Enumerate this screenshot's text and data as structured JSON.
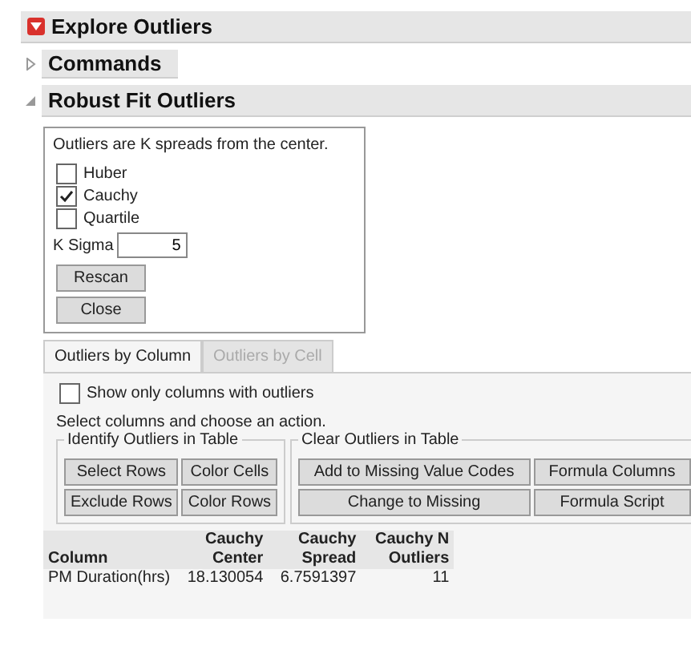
{
  "title": {
    "text": "Explore Outliers",
    "expanded": true
  },
  "commands": {
    "text": "Commands",
    "expanded": false
  },
  "robust": {
    "text": "Robust Fit Outliers",
    "expanded": true
  },
  "options": {
    "note": "Outliers are K spreads from the center.",
    "methods": [
      {
        "label": "Huber",
        "checked": false
      },
      {
        "label": "Cauchy",
        "checked": true
      },
      {
        "label": "Quartile",
        "checked": false
      }
    ],
    "k_sigma": {
      "label": "K Sigma",
      "value": "5"
    },
    "buttons": [
      "Rescan",
      "Close"
    ]
  },
  "tabs": [
    {
      "label": "Outliers by Column",
      "selected": true
    },
    {
      "label": "Outliers by Cell",
      "selected": false
    }
  ],
  "show_only": {
    "label": "Show only columns with outliers",
    "checked": false
  },
  "instruction": "Select columns and choose an action.",
  "identify": {
    "title": "Identify Outliers in Table",
    "buttons": [
      "Select Rows",
      "Color Cells",
      "Exclude Rows",
      "Color Rows"
    ]
  },
  "clear": {
    "title": "Clear Outliers in Table",
    "buttons": [
      "Add to Missing Value Codes",
      "Formula Columns",
      "Change to Missing",
      "Formula Script"
    ]
  },
  "table": {
    "columns": [
      "Column",
      "Cauchy Center",
      "Cauchy Spread",
      "Cauchy N Outliers"
    ],
    "rows": [
      [
        "PM Duration(hrs)",
        "18.130054",
        "6.7591397",
        "11"
      ]
    ]
  }
}
